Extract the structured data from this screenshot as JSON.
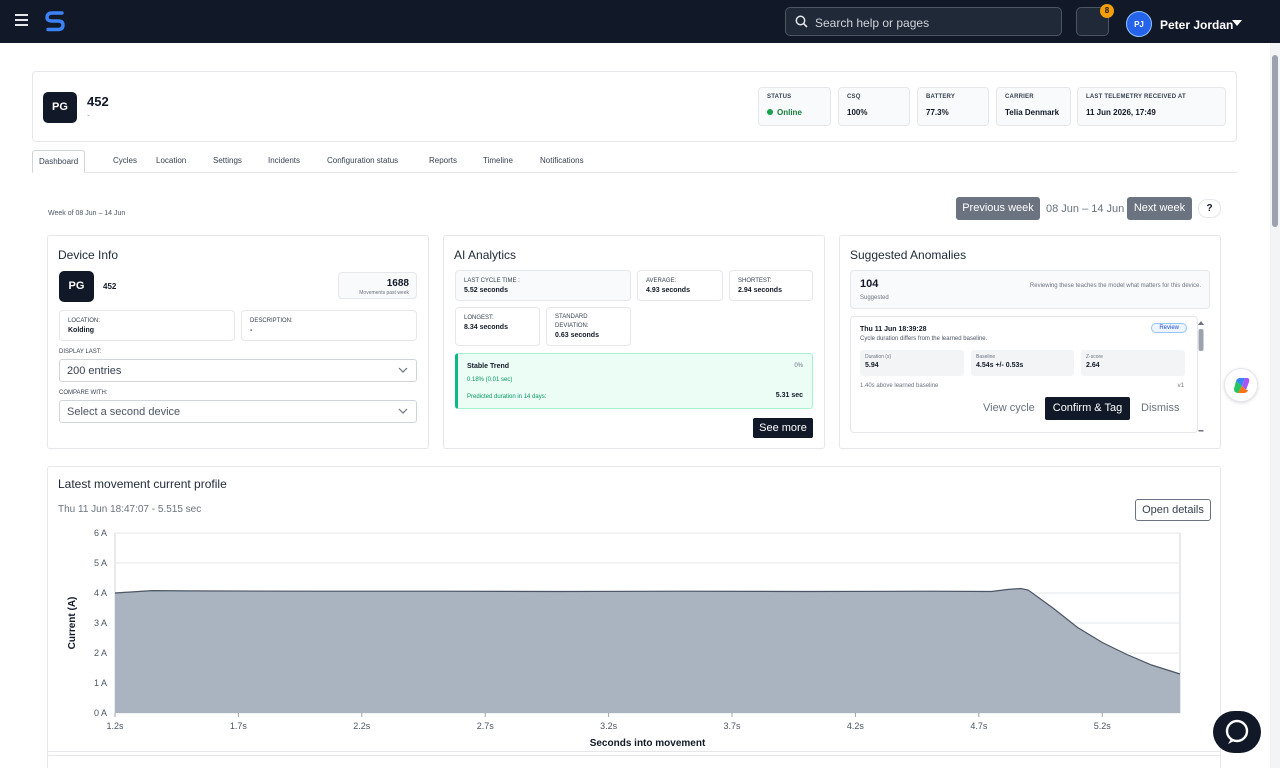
{
  "topbar": {
    "search_placeholder": "Search help or pages",
    "notifications_count": "8",
    "user_initials": "PJ",
    "user_name": "Peter Jordan"
  },
  "device": {
    "badge": "PG",
    "name": "452",
    "subtitle": "-"
  },
  "status_cards": [
    {
      "label": "STATUS",
      "value": "Online"
    },
    {
      "label": "CSQ",
      "value": "100%"
    },
    {
      "label": "BATTERY",
      "value": "77.3%"
    },
    {
      "label": "CARRIER",
      "value": "Telia Denmark"
    },
    {
      "label": "LAST TELEMETRY RECEIVED AT",
      "value": "11 Jun 2026, 17:49"
    }
  ],
  "tabs": [
    "Dashboard",
    "Cycles",
    "Location",
    "Settings",
    "Incidents",
    "Configuration status",
    "Reports",
    "Timeline",
    "Notifications"
  ],
  "week": {
    "label": "Week of 08 Jun – 14 Jun",
    "previous": "Previous week",
    "range": "08 Jun – 14 Jun",
    "next": "Next week",
    "help": "?"
  },
  "device_info": {
    "title": "Device Info",
    "badge": "PG",
    "name": "452",
    "movements_value": "1688",
    "movements_label": "Movements past week",
    "location_label": "LOCATION:",
    "location_value": "Kolding",
    "description_label": "DESCRIPTION:",
    "description_value": "-",
    "display_last_label": "DISPLAY LAST:",
    "display_last_value": "200 entries",
    "compare_label": "COMPARE WITH:",
    "compare_placeholder": "Select a second device"
  },
  "ai": {
    "title": "AI Analytics",
    "last_label": "LAST CYCLE TIME :",
    "last_value": "5.52 seconds",
    "avg_label": "AVERAGE:",
    "avg_value": "4.93 seconds",
    "short_label": "SHORTEST:",
    "short_value": "2.94 seconds",
    "long_label": "LONGEST:",
    "long_value": "8.34 seconds",
    "std_label": "STANDARD DEVIATION:",
    "std_value": "0.63 seconds",
    "trend_title": "Stable Trend",
    "trend_pct": "0%",
    "trend_sub": "0.18% (0.01 sec)",
    "predicted_label": "Predicted duration in 14 days:",
    "predicted_value": "5.31 sec",
    "see_more": "See more"
  },
  "anomalies": {
    "title": "Suggested Anomalies",
    "count": "104",
    "count_label": "Suggested",
    "note": "Reviewing these teaches the model what matters for this device.",
    "item_time": "Thu 11 Jun 18:39:28",
    "item_desc": "Cycle duration differs from the learned baseline.",
    "review": "Review",
    "duration_label": "Duration (s)",
    "duration_value": "5.94",
    "baseline_label": "Baseline",
    "baseline_value": "4.54s +/- 0.53s",
    "z_label": "Z-score",
    "z_value": "2.64",
    "above": "1.40s above learned baseline",
    "version": "v1",
    "view_cycle": "View cycle",
    "confirm": "Confirm & Tag",
    "dismiss": "Dismiss"
  },
  "profile": {
    "title": "Latest movement current profile",
    "subtitle": "Thu 11 Jun 18:47:07 - 5.515 sec",
    "open_details": "Open details"
  },
  "colors": {
    "topbar": "#111827",
    "accent": "#2563eb",
    "area_fill": "#aab4c1",
    "area_line": "#4b5563",
    "online": "#16a34a"
  },
  "chart_data": {
    "type": "area",
    "xlabel": "Seconds into movement",
    "ylabel": "Current (A)",
    "xlim": [
      1.2,
      5.515
    ],
    "ylim": [
      0,
      6
    ],
    "x_ticks": [
      "1.2s",
      "1.7s",
      "2.2s",
      "2.7s",
      "3.2s",
      "3.7s",
      "4.2s",
      "4.7s",
      "5.2s"
    ],
    "y_ticks": [
      "0 A",
      "1 A",
      "2 A",
      "3 A",
      "4 A",
      "5 A",
      "6 A"
    ],
    "grid": true,
    "x": [
      1.2,
      1.35,
      1.5,
      2.0,
      2.5,
      3.0,
      3.5,
      4.0,
      4.5,
      4.75,
      4.82,
      4.87,
      4.9,
      5.0,
      5.1,
      5.2,
      5.3,
      5.4,
      5.515
    ],
    "y": [
      4.0,
      4.08,
      4.07,
      4.06,
      4.06,
      4.05,
      4.06,
      4.05,
      4.06,
      4.05,
      4.12,
      4.15,
      4.1,
      3.5,
      2.85,
      2.35,
      1.95,
      1.6,
      1.3
    ]
  }
}
